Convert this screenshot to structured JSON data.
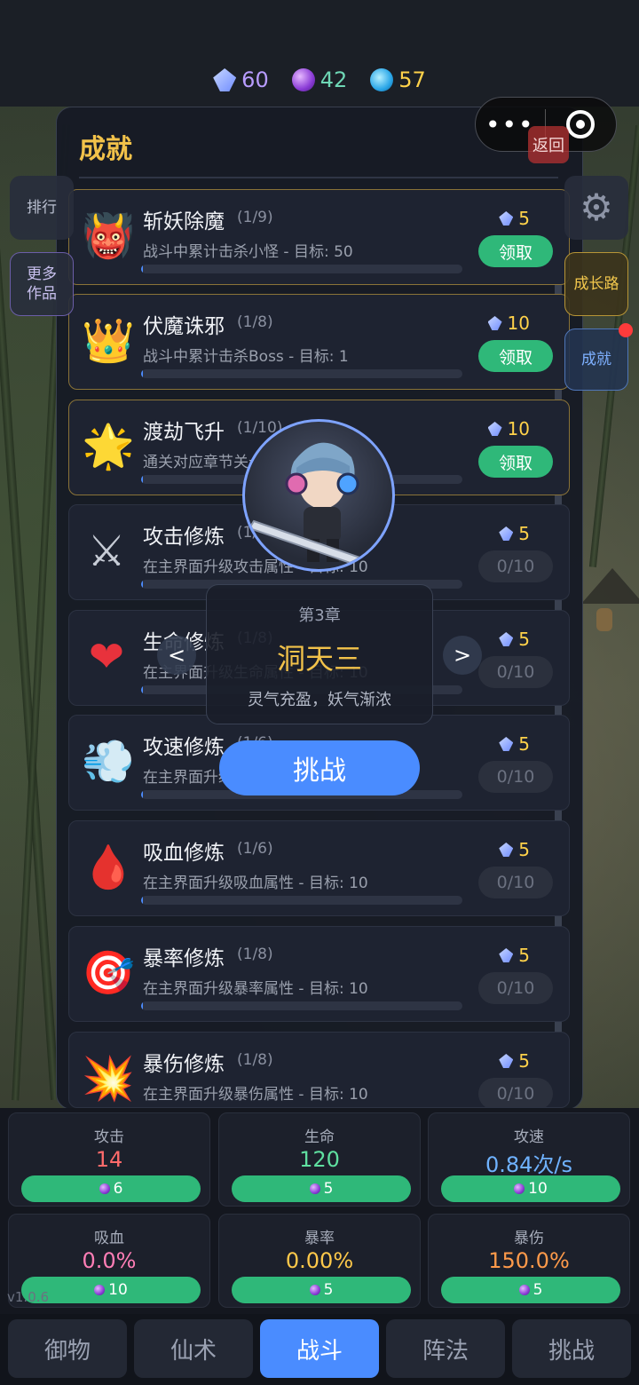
{
  "currency": [
    {
      "icon": "crystal-icon",
      "value": "60",
      "color": "#b89cff"
    },
    {
      "icon": "purple-orb-icon",
      "value": "42",
      "color": "#6ed7b5"
    },
    {
      "icon": "blue-gem-icon",
      "value": "57",
      "color": "#ffd24a"
    }
  ],
  "capsule": {
    "menu": "•••"
  },
  "panel": {
    "title": "成就",
    "back_label": "返回"
  },
  "side_left": {
    "rank": "排行",
    "more": "更多作品"
  },
  "side_right": {
    "growth": "成长路",
    "achievement": "成就"
  },
  "achievements": [
    {
      "icon": "oni-mask-icon",
      "name": "斩妖除魔",
      "progress": "(1/9)",
      "desc": "战斗中累计击杀小怪 - 目标: 50",
      "reward": "5",
      "action": "领取",
      "claimable": true
    },
    {
      "icon": "crown-icon",
      "name": "伏魔诛邪",
      "progress": "(1/8)",
      "desc": "战斗中累计击杀Boss - 目标: 1",
      "reward": "10",
      "action": "领取",
      "claimable": true
    },
    {
      "icon": "star-icon",
      "name": "渡劫飞升",
      "progress": "(1/10)",
      "desc": "通关对应章节关卡",
      "reward": "10",
      "action": "领取",
      "claimable": true
    },
    {
      "icon": "crossed-swords-icon",
      "name": "攻击修炼",
      "progress": "(1/8)",
      "desc": "在主界面升级攻击属性 - 目标: 10",
      "reward": "5",
      "action": "0/10",
      "claimable": false
    },
    {
      "icon": "heart-icon",
      "name": "生命修炼",
      "progress": "(1/8)",
      "desc": "在主界面升级生命属性 - 目标: 10",
      "reward": "5",
      "action": "0/10",
      "claimable": false
    },
    {
      "icon": "wind-icon",
      "name": "攻速修炼",
      "progress": "(1/6)",
      "desc": "在主界面升级攻速属性 - 目标: 10",
      "reward": "5",
      "action": "0/10",
      "claimable": false
    },
    {
      "icon": "blood-drop-icon",
      "name": "吸血修炼",
      "progress": "(1/6)",
      "desc": "在主界面升级吸血属性 - 目标: 10",
      "reward": "5",
      "action": "0/10",
      "claimable": false
    },
    {
      "icon": "target-icon",
      "name": "暴率修炼",
      "progress": "(1/8)",
      "desc": "在主界面升级暴率属性 - 目标: 10",
      "reward": "5",
      "action": "0/10",
      "claimable": false
    },
    {
      "icon": "explosion-icon",
      "name": "暴伤修炼",
      "progress": "(1/8)",
      "desc": "在主界面升级暴伤属性 - 目标: 10",
      "reward": "5",
      "action": "0/10",
      "claimable": false
    }
  ],
  "chapter": {
    "number": "第3章",
    "name": "洞天三",
    "desc": "灵气充盈，妖气渐浓",
    "prev": "<",
    "next": ">",
    "challenge": "挑战"
  },
  "stats": [
    {
      "label": "攻击",
      "value": "14",
      "color": "#ff6b6b",
      "cost": "6"
    },
    {
      "label": "生命",
      "value": "120",
      "color": "#5fe0a0",
      "cost": "5"
    },
    {
      "label": "攻速",
      "value": "0.84次/s",
      "color": "#6fb2ff",
      "cost": "10"
    },
    {
      "label": "吸血",
      "value": "0.0%",
      "color": "#ff7eb6",
      "cost": "10"
    },
    {
      "label": "暴率",
      "value": "0.00%",
      "color": "#ffc94a",
      "cost": "5"
    },
    {
      "label": "暴伤",
      "value": "150.0%",
      "color": "#ff9a4a",
      "cost": "5"
    }
  ],
  "version": "v1.0.6",
  "tabs": [
    "御物",
    "仙术",
    "战斗",
    "阵法",
    "挑战"
  ],
  "active_tab": "战斗"
}
